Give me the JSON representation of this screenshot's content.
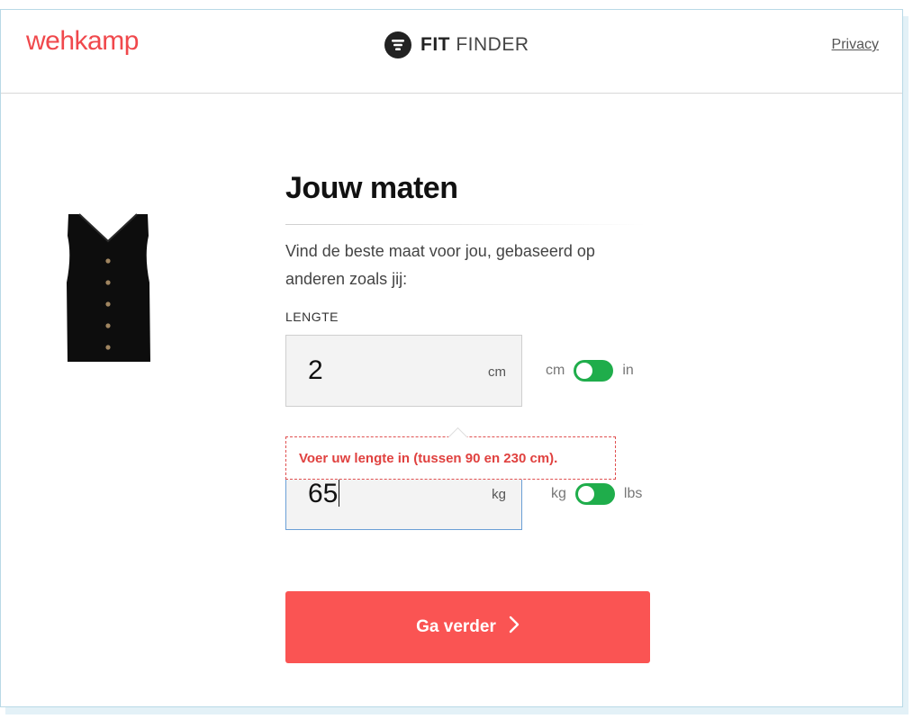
{
  "header": {
    "brand": "wehkamp",
    "fit_finder_bold": "FIT",
    "fit_finder_light": "FINDER",
    "privacy_label": "Privacy"
  },
  "product": {
    "image_alt": "black sleeveless top with buttons"
  },
  "form": {
    "title": "Jouw maten",
    "description": "Vind de beste maat voor jou, gebaseerd op anderen zoals jij:",
    "height": {
      "label": "LENGTE",
      "value": "2",
      "unit": "cm",
      "toggle_left": "cm",
      "toggle_right": "in"
    },
    "error_message": "Voer uw lengte in (tussen 90 en 230 cm).",
    "weight": {
      "value": "65",
      "unit": "kg",
      "toggle_left": "kg",
      "toggle_right": "lbs"
    },
    "submit_label": "Ga verder"
  },
  "colors": {
    "brand": "#f0484c",
    "button": "#fa5453",
    "toggle": "#1fad4b",
    "error": "#e0413f"
  }
}
